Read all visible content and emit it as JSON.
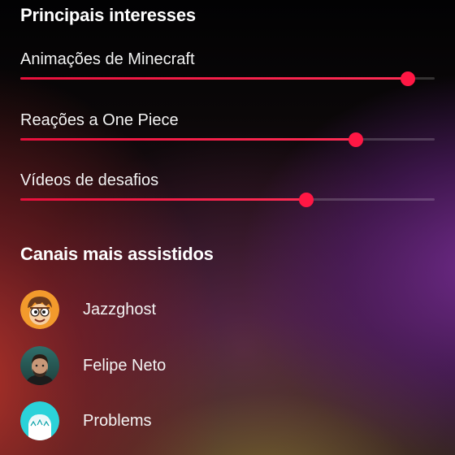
{
  "interests": {
    "title": "Principais interesses",
    "items": [
      {
        "label": "Animações de Minecraft",
        "level": 0.935
      },
      {
        "label": "Reações a One Piece",
        "level": 0.81
      },
      {
        "label": "Vídeos de desafios",
        "level": 0.69
      }
    ]
  },
  "channels": {
    "title": "Canais mais assistidos",
    "items": [
      {
        "name": "Jazzghost",
        "avatar_icon": "cartoon-face-avatar-icon"
      },
      {
        "name": "Felipe Neto",
        "avatar_icon": "person-photo-avatar-icon"
      },
      {
        "name": "Problems",
        "avatar_icon": "cyan-hair-character-avatar-icon"
      }
    ]
  },
  "colors": {
    "slider_accent": "#ff1744",
    "track": "#3a3035",
    "jazz_avatar_bg": "#f39a2c",
    "problems_avatar_bg": "#2bd2d9"
  }
}
